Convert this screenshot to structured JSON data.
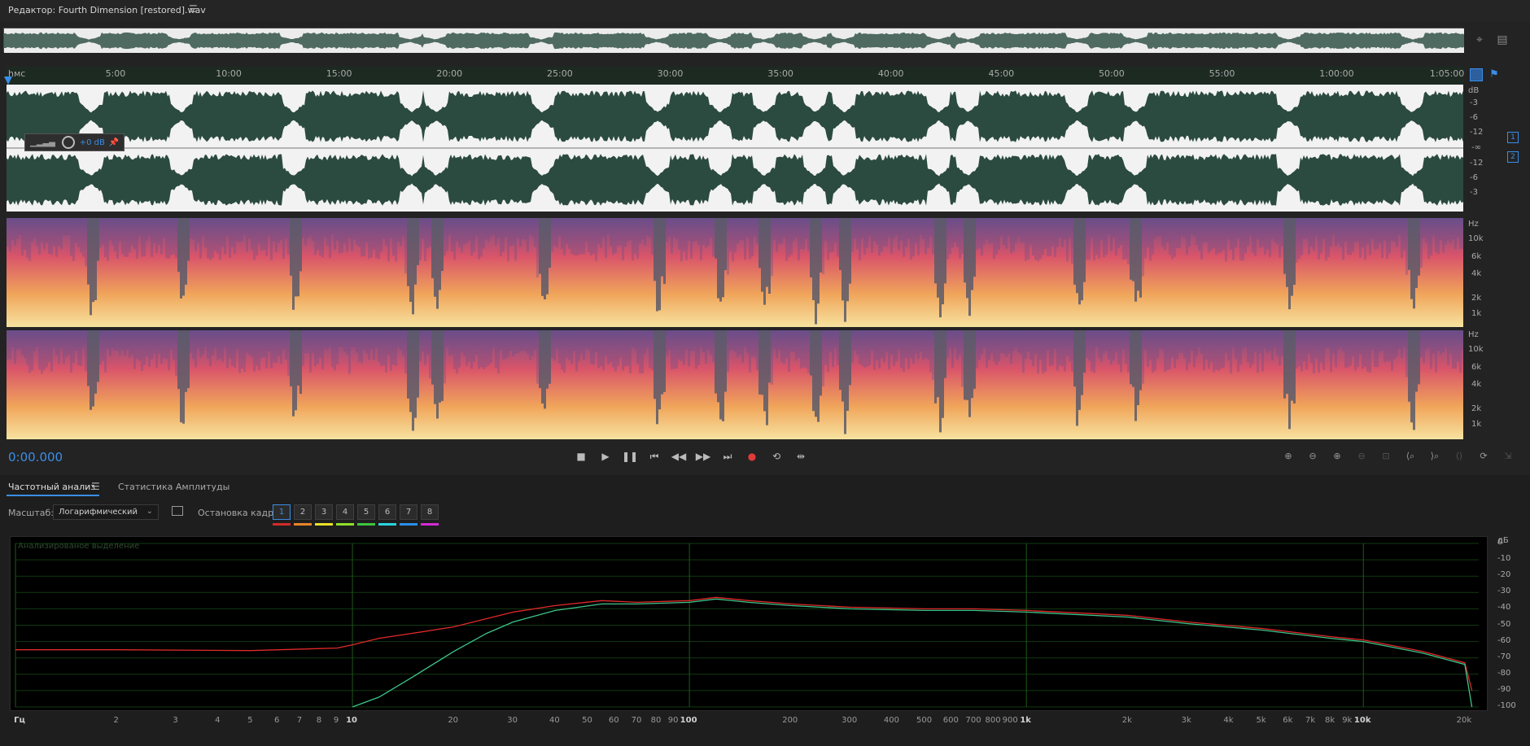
{
  "titlebar": {
    "title": "Редактор: Fourth Dimension [restored].wav",
    "menu_icon": "hamburger-icon"
  },
  "ruler": {
    "start_label": "hмс",
    "ticks": [
      "5:00",
      "10:00",
      "15:00",
      "20:00",
      "25:00",
      "30:00",
      "35:00",
      "40:00",
      "45:00",
      "50:00",
      "55:00",
      "1:00:00",
      "1:05:00"
    ]
  },
  "waveform": {
    "hud_gain": "+0 dB",
    "db_labels": [
      "dB",
      "-3",
      "-6",
      "-12",
      "-∞",
      "-12",
      "-6",
      "-3"
    ],
    "channels": [
      "1",
      "2"
    ],
    "wave_color": "#2b4a40",
    "bg_color": "#f2f2f2"
  },
  "spectral": {
    "hz_labels": [
      "Hz",
      "10k",
      "6k",
      "4k",
      "2k",
      "1k"
    ]
  },
  "transport": {
    "timecode": "0:00.000",
    "record_color": "#e03a3a"
  },
  "panel": {
    "tab_freq": "Частотный анализ",
    "tab_amp": "Статистика Амплитуды",
    "scale_label": "Масштаб:",
    "scale_value": "Логарифмический",
    "freeze_label": "Остановка кадра:",
    "freeze_buttons": [
      "1",
      "2",
      "3",
      "4",
      "5",
      "6",
      "7",
      "8"
    ],
    "freeze_colors": [
      "#d42a2a",
      "#e8842a",
      "#e8e02a",
      "#8ee02a",
      "#3ec43e",
      "#2ad4e0",
      "#2a8ee8",
      "#d42ad4"
    ],
    "analyzed_label": "Анализированое выделение",
    "db_labels": [
      "дБ",
      "0",
      "-10",
      "-20",
      "-30",
      "-40",
      "-50",
      "-60",
      "-70",
      "-80",
      "-90",
      "-100"
    ],
    "freq_labels": [
      "Гц",
      "2",
      "3",
      "4",
      "5",
      "6",
      "7",
      "8",
      "9",
      "10",
      "20",
      "30",
      "40",
      "50",
      "60",
      "70",
      "80",
      "90",
      "100",
      "200",
      "300",
      "400",
      "500",
      "600",
      "700",
      "800",
      "900",
      "1k",
      "2k",
      "3k",
      "4k",
      "5k",
      "6k",
      "7k",
      "8k",
      "9k",
      "10k",
      "20k"
    ]
  },
  "chart_data": {
    "type": "line",
    "xlabel": "Гц",
    "ylabel": "дБ",
    "x_scale": "log",
    "xlim": [
      1,
      22000
    ],
    "ylim": [
      -100,
      0
    ],
    "x": [
      1,
      2,
      5,
      9,
      10,
      12,
      15,
      20,
      25,
      30,
      40,
      55,
      70,
      100,
      120,
      150,
      200,
      300,
      500,
      700,
      1000,
      2000,
      3000,
      5000,
      8000,
      10000,
      15000,
      20000,
      21000
    ],
    "series": [
      {
        "name": "",
        "color": "#e02a2a",
        "values": [
          -65,
          -65,
          -65.5,
          -64,
          -62,
          -58,
          -55,
          -51,
          -46,
          -42,
          -38,
          -35,
          -36,
          -35,
          -33,
          -35,
          -37,
          -39,
          -40,
          -40,
          -41,
          -44,
          -48,
          -52,
          -57,
          -59,
          -66,
          -73,
          -90
        ]
      },
      {
        "name": "",
        "color": "#3ec48a",
        "values": [
          null,
          null,
          null,
          null,
          -100,
          -94,
          -82,
          -66,
          -55,
          -48,
          -41,
          -37,
          -37,
          -36,
          -34,
          -36,
          -38,
          -40,
          -41,
          -41,
          -42,
          -45,
          -49,
          -53,
          -58,
          -60,
          -67,
          -74,
          -100
        ]
      }
    ]
  }
}
